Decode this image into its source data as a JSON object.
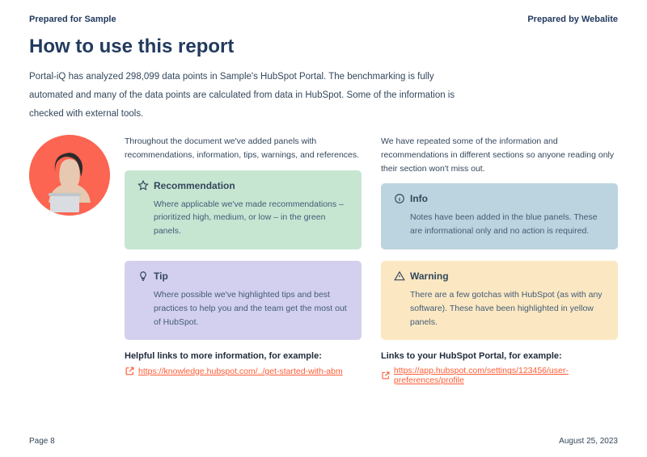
{
  "header": {
    "prepared_for": "Prepared for Sample",
    "prepared_by": "Prepared by Webalite"
  },
  "title": "How to use this report",
  "intro": "Portal-iQ has analyzed 298,099 data points in Sample's HubSpot Portal. The benchmarking is fully automated and many of the data points are calculated from data in HubSpot. Some of the information is checked with external tools.",
  "left": {
    "lead": "Throughout the document we've added panels with recommendations, information, tips, warnings, and references.",
    "recommendation": {
      "title": "Recommendation",
      "body": "Where applicable we've made recommendations – prioritized high, medium, or low – in the green panels."
    },
    "tip": {
      "title": "Tip",
      "body": "Where possible we've highlighted tips and best practices to help you and the team get the most out of HubSpot."
    },
    "link_head": "Helpful links to more information, for example:",
    "link": "https://knowledge.hubspot.com/../get-started-with-abm"
  },
  "right": {
    "lead": "We have repeated some of the information and recommendations in different sections so anyone reading only their section won't miss out.",
    "info": {
      "title": "Info",
      "body": "Notes have been added in the blue panels. These are informational only and no action is required."
    },
    "warning": {
      "title": "Warning",
      "body": "There are a few gotchas with HubSpot (as with any software). These have been highlighted in yellow panels."
    },
    "link_head": "Links to your HubSpot Portal, for example:",
    "link": "https://app.hubspot.com/settings/123456/user-preferences/profile"
  },
  "footer": {
    "page": "Page 8",
    "date": "August 25, 2023"
  }
}
